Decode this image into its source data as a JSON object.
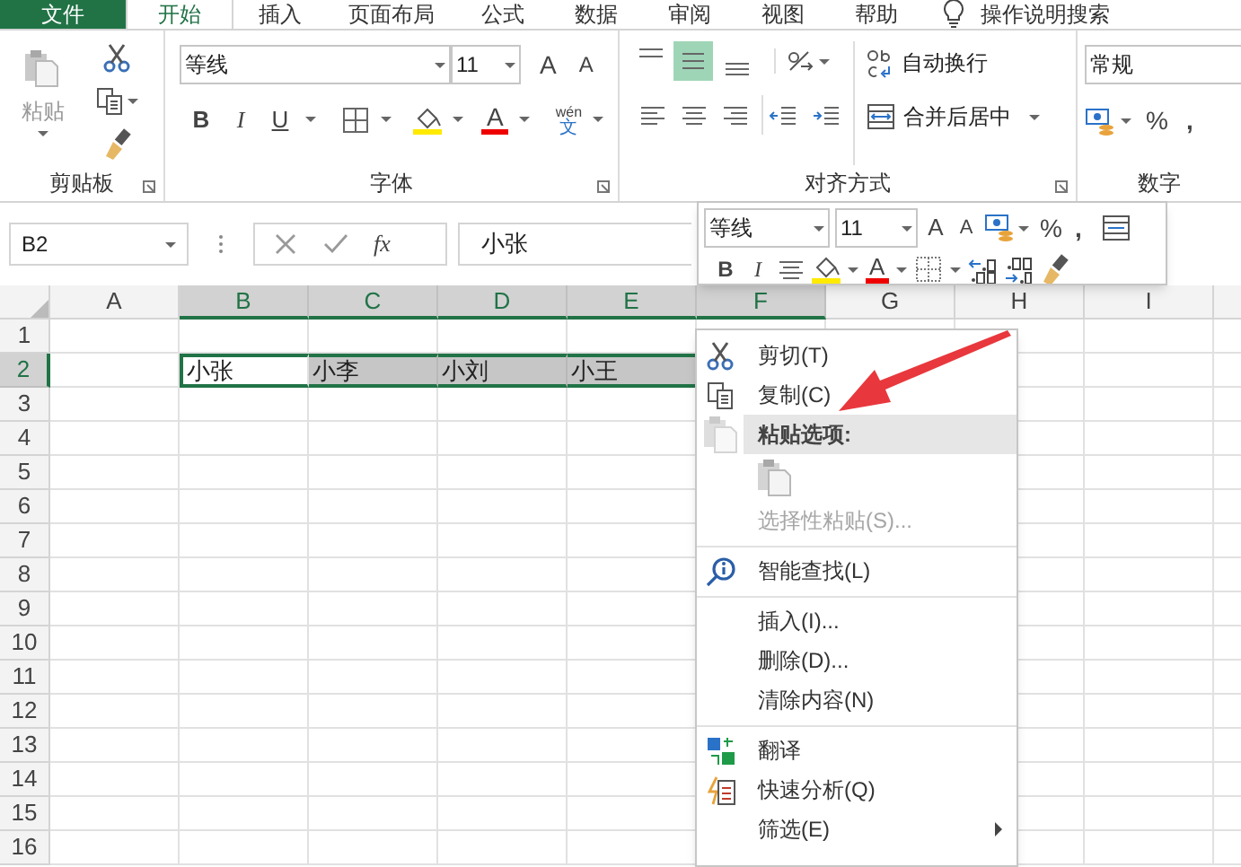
{
  "ribbon_tabs": [
    {
      "label": "文件",
      "kind": "file",
      "selected": false
    },
    {
      "label": "开始",
      "kind": "tab",
      "selected": true
    },
    {
      "label": "插入",
      "kind": "tab",
      "selected": false
    },
    {
      "label": "页面布局",
      "kind": "tab",
      "selected": false
    },
    {
      "label": "公式",
      "kind": "tab",
      "selected": false
    },
    {
      "label": "数据",
      "kind": "tab",
      "selected": false
    },
    {
      "label": "审阅",
      "kind": "tab",
      "selected": false
    },
    {
      "label": "视图",
      "kind": "tab",
      "selected": false
    },
    {
      "label": "帮助",
      "kind": "tab",
      "selected": false
    },
    {
      "label": "操作说明搜索",
      "kind": "search",
      "selected": false
    }
  ],
  "clipboard": {
    "paste": "粘贴",
    "label": "剪贴板"
  },
  "font": {
    "name": "等线",
    "size": "11",
    "grow": "A",
    "shrink": "A",
    "bold": "B",
    "italic": "I",
    "underline": "U",
    "font_color_button": "A",
    "phonetic_top": "wén",
    "phonetic_bottom": "文",
    "label": "字体"
  },
  "alignment": {
    "wrap": "自动换行",
    "merge": "合并后居中",
    "label": "对齐方式",
    "align_options": [
      {
        "selected": false
      },
      {
        "selected": true
      },
      {
        "selected": false
      }
    ]
  },
  "number": {
    "format": "常规",
    "percent": "%",
    "comma": ",",
    "label": "数字"
  },
  "formula_bar": {
    "name_box": "B2",
    "fx": "fx",
    "value": "小张"
  },
  "columns": [
    {
      "label": "A",
      "selected": false
    },
    {
      "label": "B",
      "selected": true
    },
    {
      "label": "C",
      "selected": true
    },
    {
      "label": "D",
      "selected": true
    },
    {
      "label": "E",
      "selected": true
    },
    {
      "label": "F",
      "selected": true
    },
    {
      "label": "G",
      "selected": false
    },
    {
      "label": "H",
      "selected": false
    },
    {
      "label": "I",
      "selected": false
    }
  ],
  "rows": [
    {
      "label": "1",
      "selected": false,
      "cells": []
    },
    {
      "label": "2",
      "selected": true,
      "cells": [
        null,
        {
          "value": "小张",
          "active": true
        },
        {
          "value": "小李",
          "active": false
        },
        {
          "value": "小刘",
          "active": false
        },
        {
          "value": "小王",
          "active": false
        },
        null,
        null,
        null,
        null
      ]
    },
    {
      "label": "3",
      "selected": false,
      "cells": []
    },
    {
      "label": "4",
      "selected": false,
      "cells": []
    },
    {
      "label": "5",
      "selected": false,
      "cells": []
    },
    {
      "label": "6",
      "selected": false,
      "cells": []
    },
    {
      "label": "7",
      "selected": false,
      "cells": []
    },
    {
      "label": "8",
      "selected": false,
      "cells": []
    },
    {
      "label": "9",
      "selected": false,
      "cells": []
    },
    {
      "label": "10",
      "selected": false,
      "cells": []
    },
    {
      "label": "11",
      "selected": false,
      "cells": []
    },
    {
      "label": "12",
      "selected": false,
      "cells": []
    },
    {
      "label": "13",
      "selected": false,
      "cells": []
    },
    {
      "label": "14",
      "selected": false,
      "cells": []
    },
    {
      "label": "15",
      "selected": false,
      "cells": []
    },
    {
      "label": "16",
      "selected": false,
      "cells": []
    }
  ],
  "mini_toolbar": {
    "font": "等线",
    "size": "11",
    "grow": "A",
    "shrink": "A",
    "percent": "%",
    "comma": ",",
    "bold": "B",
    "italic": "I",
    "font_color_button": "A"
  },
  "context_menu": [
    {
      "label": "剪切(T)",
      "kind": "item",
      "separator_before": false,
      "submenu": false
    },
    {
      "label": "复制(C)",
      "kind": "item",
      "separator_before": false,
      "submenu": false
    },
    {
      "label": "粘贴选项:",
      "kind": "header",
      "separator_before": false,
      "submenu": false
    },
    {
      "kind": "paste_icons",
      "separator_before": false,
      "submenu": false
    },
    {
      "label": "选择性粘贴(S)...",
      "kind": "disabled",
      "separator_before": false,
      "submenu": false
    },
    {
      "label": "智能查找(L)",
      "kind": "item",
      "separator_before": true,
      "submenu": false
    },
    {
      "label": "插入(I)...",
      "kind": "item",
      "separator_before": true,
      "submenu": false
    },
    {
      "label": "删除(D)...",
      "kind": "item",
      "separator_before": false,
      "submenu": false
    },
    {
      "label": "清除内容(N)",
      "kind": "item",
      "separator_before": false,
      "submenu": false
    },
    {
      "label": "翻译",
      "kind": "item",
      "separator_before": true,
      "submenu": false
    },
    {
      "label": "快速分析(Q)",
      "kind": "item",
      "separator_before": false,
      "submenu": false
    },
    {
      "label": "筛选(E)",
      "kind": "item",
      "separator_before": false,
      "submenu": true
    }
  ]
}
